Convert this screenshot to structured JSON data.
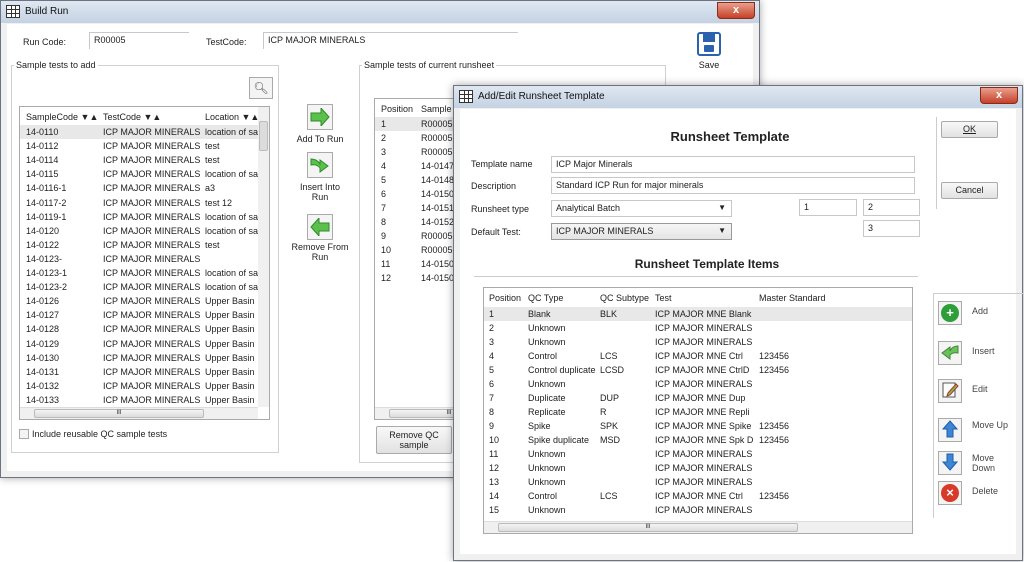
{
  "build_run": {
    "title": "Build Run",
    "close": "x",
    "run_code_label": "Run Code:",
    "run_code": "R00005",
    "test_code_label": "TestCode:",
    "test_code": "ICP MAJOR MINERALS",
    "save_label": "Save",
    "left_group": "Sample tests to add",
    "left_columns": [
      "SampleCode ▼▲",
      "TestCode ▼▲",
      "Location ▼▲"
    ],
    "left_rows": [
      [
        "14-0110",
        "ICP MAJOR MINERALS",
        "location of sa"
      ],
      [
        "14-0112",
        "ICP MAJOR MINERALS",
        "test"
      ],
      [
        "14-0114",
        "ICP MAJOR MINERALS",
        "test"
      ],
      [
        "14-0115",
        "ICP MAJOR MINERALS",
        "location of sa"
      ],
      [
        "14-0116-1",
        "ICP MAJOR MINERALS",
        "a3"
      ],
      [
        "14-0117-2",
        "ICP MAJOR MINERALS",
        "test 12"
      ],
      [
        "14-0119-1",
        "ICP MAJOR MINERALS",
        "location of sa"
      ],
      [
        "14-0120",
        "ICP MAJOR MINERALS",
        "location of sa"
      ],
      [
        "14-0122",
        "ICP MAJOR MINERALS",
        "test"
      ],
      [
        "14-0123-",
        "ICP MAJOR MINERALS",
        ""
      ],
      [
        "14-0123-1",
        "ICP MAJOR MINERALS",
        "location of sa"
      ],
      [
        "14-0123-2",
        "ICP MAJOR MINERALS",
        "location of sa"
      ],
      [
        "14-0126",
        "ICP MAJOR MINERALS",
        "Upper Basin"
      ],
      [
        "14-0127",
        "ICP MAJOR MINERALS",
        "Upper Basin"
      ],
      [
        "14-0128",
        "ICP MAJOR MINERALS",
        "Upper Basin"
      ],
      [
        "14-0129",
        "ICP MAJOR MINERALS",
        "Upper Basin"
      ],
      [
        "14-0130",
        "ICP MAJOR MINERALS",
        "Upper Basin"
      ],
      [
        "14-0131",
        "ICP MAJOR MINERALS",
        "Upper Basin"
      ],
      [
        "14-0132",
        "ICP MAJOR MINERALS",
        "Upper Basin"
      ],
      [
        "14-0133",
        "ICP MAJOR MINERALS",
        "Upper Basin"
      ]
    ],
    "include_reusable": "Include reusable QC sample tests",
    "add_to_run": "Add To Run",
    "insert_into_run": "Insert Into Run",
    "remove_from_run": "Remove From Run",
    "right_group": "Sample tests of current runsheet",
    "right_columns": [
      "Position",
      "Sample"
    ],
    "right_rows": [
      [
        "1",
        "R00005-"
      ],
      [
        "2",
        "R00005-"
      ],
      [
        "3",
        "R00005-"
      ],
      [
        "4",
        "14-0147"
      ],
      [
        "5",
        "14-0148"
      ],
      [
        "6",
        "14-0150"
      ],
      [
        "7",
        "14-0151"
      ],
      [
        "8",
        "14-0152"
      ],
      [
        "9",
        "R00005-"
      ],
      [
        "10",
        "R00005-"
      ],
      [
        "11",
        "14-0150-"
      ],
      [
        "12",
        "14-0150-"
      ]
    ],
    "remove_qc": "Remove QC sample"
  },
  "dialog": {
    "title": "Add/Edit Runsheet Template",
    "close": "x",
    "heading": "Runsheet Template",
    "template_name_label": "Template name",
    "template_name": "ICP Major Minerals",
    "description_label": "Description",
    "description": "Standard ICP Run for major minerals",
    "runsheet_type_label": "Runsheet type",
    "runsheet_type": "Analytical Batch",
    "default_test_label": "Default Test:",
    "default_test": "ICP MAJOR MINERALS",
    "box1": "1",
    "box2": "2",
    "box3": "3",
    "ok": "OK",
    "cancel": "Cancel",
    "items_heading": "Runsheet Template Items",
    "columns": [
      "Position",
      "QC Type",
      "QC Subtype",
      "Test",
      "Master Standard"
    ],
    "rows": [
      [
        "1",
        "Blank",
        "BLK",
        "ICP MAJOR MNE Blank",
        ""
      ],
      [
        "2",
        "Unknown",
        "",
        "ICP MAJOR MINERALS",
        ""
      ],
      [
        "3",
        "Unknown",
        "",
        "ICP MAJOR MINERALS",
        ""
      ],
      [
        "4",
        "Control",
        "LCS",
        "ICP MAJOR MNE Ctrl",
        "123456"
      ],
      [
        "5",
        "Control duplicate",
        "LCSD",
        "ICP MAJOR MNE CtrlD",
        "123456"
      ],
      [
        "6",
        "Unknown",
        "",
        "ICP MAJOR MINERALS",
        ""
      ],
      [
        "7",
        "Duplicate",
        "DUP",
        "ICP MAJOR MNE Dup",
        ""
      ],
      [
        "8",
        "Replicate",
        "R",
        "ICP MAJOR MNE Repli",
        ""
      ],
      [
        "9",
        "Spike",
        "SPK",
        "ICP MAJOR MNE Spike",
        "123456"
      ],
      [
        "10",
        "Spike duplicate",
        "MSD",
        "ICP MAJOR MNE Spk D",
        "123456"
      ],
      [
        "11",
        "Unknown",
        "",
        "ICP MAJOR MINERALS",
        ""
      ],
      [
        "12",
        "Unknown",
        "",
        "ICP MAJOR MINERALS",
        ""
      ],
      [
        "13",
        "Unknown",
        "",
        "ICP MAJOR MINERALS",
        ""
      ],
      [
        "14",
        "Control",
        "LCS",
        "ICP MAJOR MNE Ctrl",
        "123456"
      ],
      [
        "15",
        "Unknown",
        "",
        "ICP MAJOR MINERALS",
        ""
      ]
    ],
    "actions": {
      "add": "Add",
      "insert": "Insert",
      "edit": "Edit",
      "move_up": "Move Up",
      "move_down": "Move Down",
      "delete": "Delete"
    }
  }
}
